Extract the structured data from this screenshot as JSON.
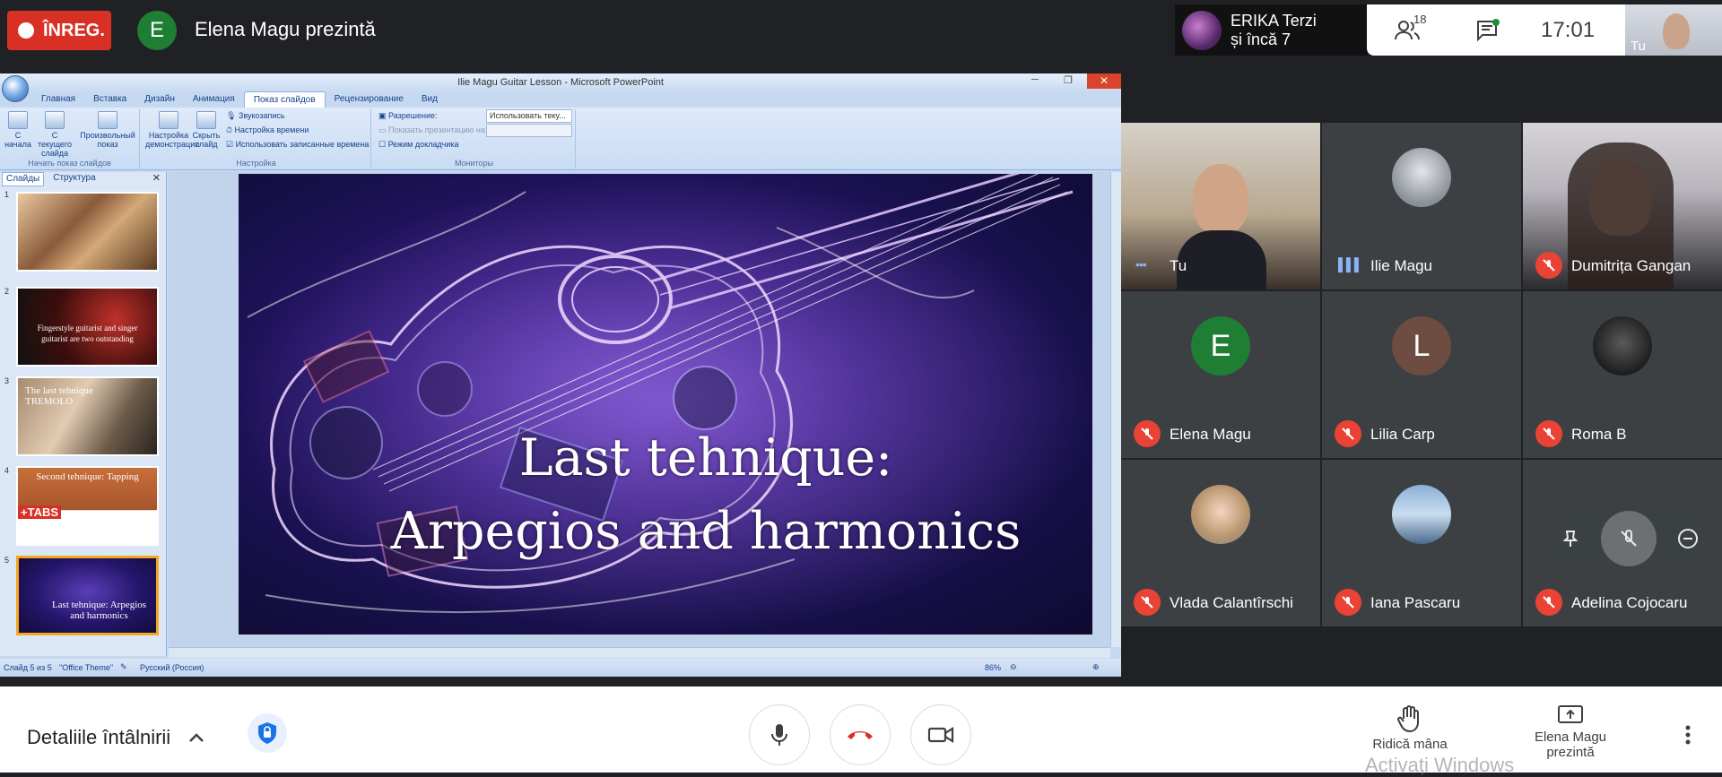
{
  "top_bar": {
    "rec_label": "ÎNREG.",
    "presenter_initial": "E",
    "presenting_text": "Elena Magu prezintă",
    "active_speaker_line1": "ERIKA Terzi",
    "active_speaker_line2": "și încă 7",
    "people_count": "18",
    "clock": "17:01",
    "self_label": "Tu"
  },
  "powerpoint": {
    "window_title": "Ilie Magu  Guitar Lesson - Microsoft PowerPoint",
    "tabs": [
      "Главная",
      "Вставка",
      "Дизайн",
      "Анимация",
      "Показ слайдов",
      "Рецензирование",
      "Вид"
    ],
    "active_tab": "Показ слайдов",
    "ribbon": {
      "from_start": "С начала",
      "from_current": "С текущего слайда",
      "custom_show": "Произвольный показ",
      "group1_caption": "Начать показ слайдов",
      "setup_show": "Настройка демонстрации",
      "hide_slide": "Скрыть слайд",
      "record_narration": "Звукозапись",
      "rehearse_timings": "Настройка времени",
      "use_timings": "Использовать записанные времена",
      "group2_caption": "Настройка",
      "resolution_label": "Разрешение:",
      "resolution_value": "Использовать теку...",
      "show_on_label": "Показать презентацию на:",
      "presenter_view": "Режим докладчика",
      "group3_caption": "Мониторы"
    },
    "panel_tabs": [
      "Слайды",
      "Структура"
    ],
    "thumbnails": [
      {
        "num": "1",
        "text": ""
      },
      {
        "num": "2",
        "text": "Fingerstyle guitarist and singer guitarist are two outstanding"
      },
      {
        "num": "3",
        "text": "The last tehnique TREMOLO"
      },
      {
        "num": "4",
        "text": "Second tehnique: Tapping"
      },
      {
        "num": "5",
        "text": "Last tehnique: Arpegios and harmonics"
      }
    ],
    "thumb4_badge": "+TABS",
    "slide_title_line1": "Last tehnique:",
    "slide_title_line2": "Arpegios and harmonics",
    "status_slide": "Слайд 5 из 5",
    "status_theme": "\"Office Theme\"",
    "status_lang": "Русский (Россия)",
    "status_zoom": "86%"
  },
  "participants": [
    {
      "name": "Tu",
      "type": "photo",
      "state": "speaking"
    },
    {
      "name": "Ilie Magu",
      "type": "avatar-photo",
      "state": "speaking"
    },
    {
      "name": "Dumitrița Gangan",
      "type": "photo",
      "state": "muted"
    },
    {
      "name": "Elena Magu",
      "type": "initial",
      "initial": "E",
      "color": "#1e7e34",
      "state": "muted"
    },
    {
      "name": "Lilia Carp",
      "type": "initial",
      "initial": "L",
      "color": "#6d4c41",
      "state": "muted"
    },
    {
      "name": "Roma B",
      "type": "avatar-photo",
      "state": "muted"
    },
    {
      "name": "Vlada Calantîrschi",
      "type": "avatar-photo",
      "state": "muted"
    },
    {
      "name": "Iana Pascaru",
      "type": "avatar-photo",
      "state": "muted"
    },
    {
      "name": "Adelina Cojocaru",
      "type": "avatar-photo",
      "state": "muted"
    }
  ],
  "bottom_bar": {
    "meeting_details": "Detaliile întâlnirii",
    "raise_hand": "Ridică mâna",
    "presenting_line1": "Elena Magu",
    "presenting_line2": "prezintă",
    "watermark": "Activați Windows"
  },
  "colors": {
    "rec_red": "#d93025",
    "meet_dark": "#202124",
    "mute_red": "#ea4335",
    "office_blue": "#c6d9f0"
  }
}
